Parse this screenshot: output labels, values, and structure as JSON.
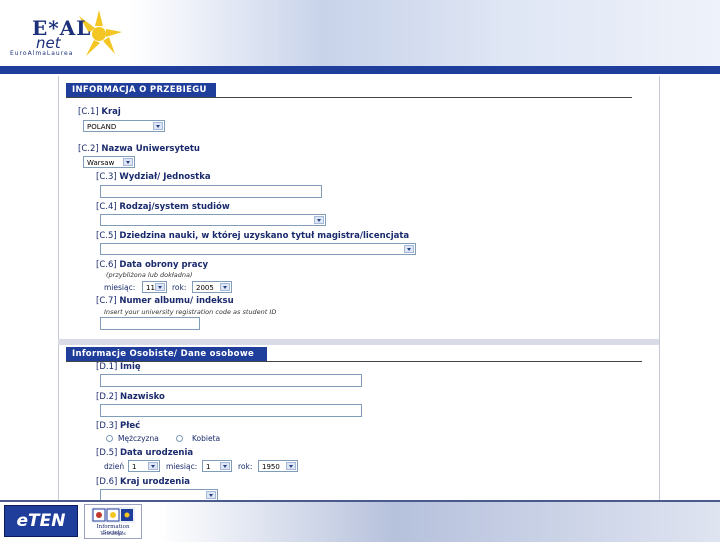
{
  "header": {
    "logo_main": "E*AL",
    "logo_sub": "net",
    "logo_tagline": "EuroAlmaLaurea",
    "brand_color": "#1f3d9a"
  },
  "section_c": {
    "title": "INFORMACJA O PRZEBIEGU",
    "c1_code": "[C.1]",
    "c1_label": "Kraj",
    "c1_value": "POLAND",
    "c2_code": "[C.2]",
    "c2_label": "Nazwa Uniwersytetu",
    "c2_value": "Warsaw",
    "c3_code": "[C.3]",
    "c3_label": "Wydział/ Jednostka",
    "c4_code": "[C.4]",
    "c4_label": "Rodzaj/system studiów",
    "c5_code": "[C.5]",
    "c5_label": "Dziedzina nauki, w której uzyskano tytuł magistra/licencjata",
    "c6_code": "[C.6]",
    "c6_label": "Data obrony pracy",
    "c6_hint": "(przybliżona lub dokładna)",
    "c6_month_label": "miesiąc:",
    "c6_month_value": "11",
    "c6_year_label": "rok:",
    "c6_year_value": "2005",
    "c7_code": "[C.7]",
    "c7_label": "Numer albumu/ indeksu",
    "c7_hint": "Insert your university registration code as student ID"
  },
  "section_d": {
    "title": "Informacje Osobiste/ Dane osobowe",
    "d1_code": "[D.1]",
    "d1_label": "Imię",
    "d2_code": "[D.2]",
    "d2_label": "Nazwisko",
    "d3_code": "[D.3]",
    "d3_label": "Płeć",
    "d3_opt_male": "Mężczyzna",
    "d3_opt_female": "Kobieta",
    "d5_code": "[D.5]",
    "d5_label": "Data urodzenia",
    "d5_day_label": "dzień",
    "d5_day_value": "1",
    "d5_month_label": "miesiąc:",
    "d5_month_value": "1",
    "d5_year_label": "rok:",
    "d5_year_value": "1950",
    "d6_code": "[D.6]",
    "d6_label": "Kraj urodzenia"
  },
  "footer": {
    "eten_logo": "eTEN",
    "infosoc_title": "Information Society",
    "infosoc_sub": "Technologies"
  }
}
